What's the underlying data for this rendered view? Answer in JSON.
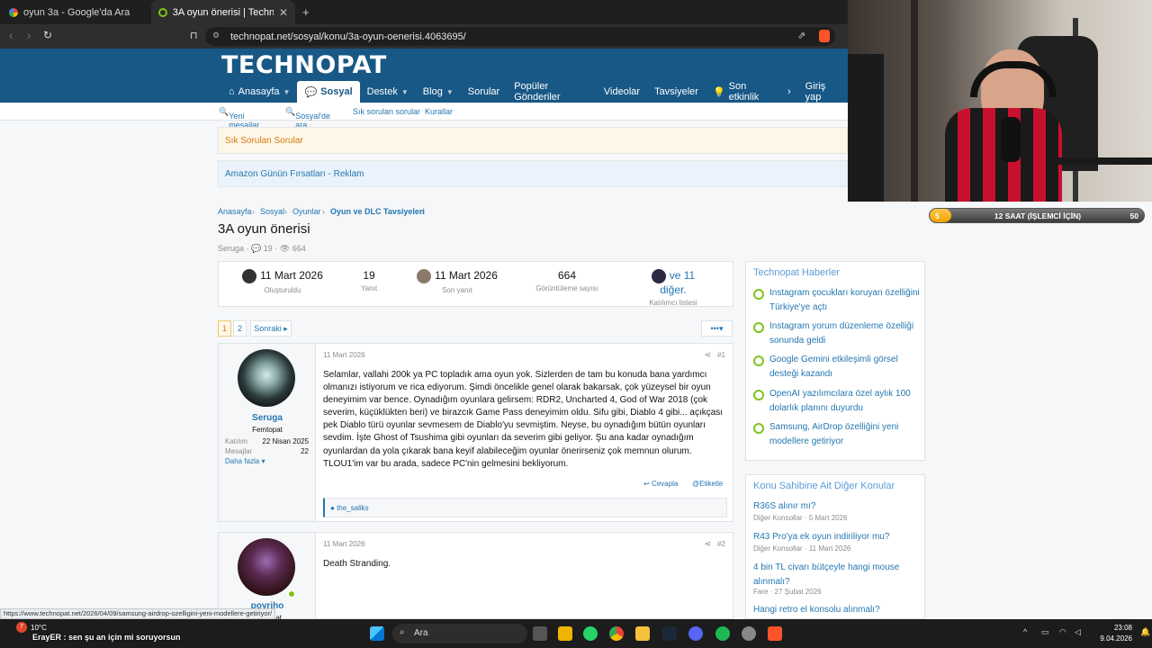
{
  "browser": {
    "tabs": [
      {
        "title": "oyun 3a - Google'da Ara"
      },
      {
        "title": "3A oyun önerisi | Technopat Sos"
      }
    ],
    "url": "technopat.net/sosyal/konu/3a-oyun-oenerisi.4063695/"
  },
  "site": {
    "logo": "TECHNOPAT",
    "nav": [
      "Anasayfa",
      "Sosyal",
      "Destek",
      "Blog",
      "Sorular",
      "Popüler Gönderiler",
      "Videolar",
      "Tavsiyeler",
      "Son etkinlik"
    ],
    "login": "Giriş yap",
    "subnav": [
      "Yeni mesajlar",
      "Sosyal'de ara",
      "Sık sorulan sorular",
      "Kurallar"
    ],
    "notices": [
      "Sık Sorulan Sorular",
      "Amazon Günün Fırsatları - Reklam"
    ],
    "breadcrumb": [
      "Anasayfa",
      "Sosyal",
      "Oyunlar",
      "Oyun ve DLC Tavsiyeleri"
    ]
  },
  "thread": {
    "title": "3A oyun önerisi",
    "author": "Seruga",
    "replies_icon": "19",
    "views_icon": "664",
    "stats": [
      {
        "value": "11 Mart 2026",
        "label": "Oluşturuldu"
      },
      {
        "value": "19",
        "label": "Yanıt"
      },
      {
        "value": "11 Mart 2026",
        "label": "Son yanıt"
      },
      {
        "value": "664",
        "label": "Görüntüleme sayısı"
      },
      {
        "value": "ve 11 diğer.",
        "label": "Katılımcı listesi"
      }
    ],
    "pagination": {
      "pages": [
        "1",
        "2"
      ],
      "next": "Sonraki",
      "more": "•••"
    }
  },
  "posts": [
    {
      "user": "Seruga",
      "rank": "Femtopat",
      "joined_label": "Katılım",
      "joined": "22 Nisan 2025",
      "messages_label": "Mesajlar",
      "messages": "22",
      "more": "Daha fazla",
      "date": "11 Mart 2026",
      "number": "#1",
      "text": "Selamlar, vallahi 200k ya PC topladık ama oyun yok. Sizlerden de tam bu konuda bana yardımcı olmanızı istiyorum ve rica ediyorum. Şimdi öncelikle genel olarak bakarsak, çok yüzeysel bir oyun deneyimim var bence. Oynadığım oyunlara gelirsem: RDR2, Uncharted 4, God of War 2018 (çok severim, küçüklükten beri) ve birazcık Game Pass deneyimim oldu. Sifu gibi, Diablo 4 gibi... açıkçası pek Diablo türü oyunlar sevmesem de Diablo'yu sevmiştim. Neyse, bu oynadığım bütün oyunları sevdim. İşte Ghost of Tsushima gibi oyunları da severim gibi geliyor. Şu ana kadar oynadığım oyunlardan da yola çıkarak bana keyif alabileceğim oyunlar önerirseniz çok memnun olurum. TLOU1'im var bu arada, sadece PC'nin gelmesini bekliyorum.",
      "reply": "Cevapla",
      "tag": "Etiketle",
      "reaction": "the_saliks"
    },
    {
      "user": "poyriho",
      "rank": "Hectopat",
      "date": "11 Mart 2026",
      "number": "#2",
      "text": "Death Stranding."
    }
  ],
  "sidebar": {
    "news_title": "Technopat Haberler",
    "news": [
      "Instagram çocukları koruyan özelliğini Türkiye'ye açtı",
      "Instagram yorum düzenleme özelliği sonunda geldi",
      "Google Gemini etkileşimli görsel desteği kazandı",
      "OpenAI yazılımcılara özel aylık 100 dolarlık planını duyurdu",
      "Samsung, AirDrop özelliğini yeni modellere getiriyor"
    ],
    "other_title": "Konu Sahibine Ait Diğer Konular",
    "other": [
      {
        "title": "R36S alınır mı?",
        "meta": "Diğer Konsollar · 5 Mart 2026"
      },
      {
        "title": "R43 Pro'ya ek oyun indiriliyor mu?",
        "meta": "Diğer Konsollar · 11 Mart 2026"
      },
      {
        "title": "4 bin TL civarı bütçeyle hangi mouse alınmalı?",
        "meta": "Fare · 27 Şubat 2026"
      },
      {
        "title": "Hangi retro el konsolu alınmalı?",
        "meta": ""
      }
    ]
  },
  "overlay": {
    "progress_start": "5",
    "progress_end": "50",
    "progress_label": "12 SAAT (İŞLEMCİ İÇİN)",
    "progress_fraction": 0.1,
    "status_url": "https://www.technopat.net/2026/04/09/samsung-airdrop-ozelligini-yeni-modellere-getiriyor/",
    "chat": "ErayER : sen şu an için mi soruyorsun",
    "chat_badge": "7"
  },
  "taskbar": {
    "weather": "10°C",
    "search": "Ara",
    "time": "23:08",
    "date": "9.04.2026"
  }
}
